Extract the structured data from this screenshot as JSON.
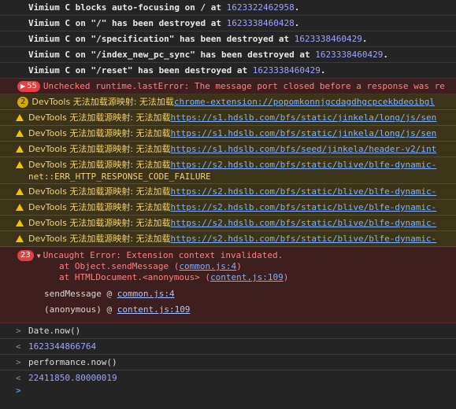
{
  "logs": [
    {
      "prefix": "Vimium C blocks auto-focusing on / at ",
      "num": "1623322462958",
      "suffix": "."
    },
    {
      "prefix": "Vimium C on \"/\" has been destroyed at ",
      "num": "1623338460428",
      "suffix": "."
    },
    {
      "prefix": "Vimium C on \"/specification\" has been destroyed at ",
      "num": "1623338460429",
      "suffix": "."
    },
    {
      "prefix": "Vimium C on \"/index_new_pc_sync\" has been destroyed at ",
      "num": "1623338460429",
      "suffix": "."
    },
    {
      "prefix": "Vimium C on \"/reset\" has been destroyed at ",
      "num": "1623338460429",
      "suffix": "."
    }
  ],
  "runtime_error": {
    "count": "55",
    "text": "Unchecked runtime.lastError: The message port closed before a response was re"
  },
  "warnings": [
    {
      "badge": "2",
      "prefix": "DevTools 无法加载源映射:  无法加载",
      "link": "chrome-extension://popomkonnjgcdagdhgcpcekbdeoibgl"
    },
    {
      "prefix": "DevTools 无法加载源映射:  无法加载",
      "link": "https://s1.hdslb.com/bfs/static/jinkela/long/js/sen"
    },
    {
      "prefix": "DevTools 无法加载源映射:  无法加载",
      "link": "https://s1.hdslb.com/bfs/static/jinkela/long/js/sen"
    },
    {
      "prefix": "DevTools 无法加载源映射:  无法加载",
      "link": "https://s1.hdslb.com/bfs/seed/jinkela/header-v2/int"
    },
    {
      "prefix": "DevTools 无法加载源映射:  无法加载",
      "link": "https://s2.hdslb.com/bfs/static/blive/blfe-dynamic-",
      "extra": "net::ERR_HTTP_RESPONSE_CODE_FAILURE"
    },
    {
      "prefix": "DevTools 无法加载源映射:  无法加载",
      "link": "https://s2.hdslb.com/bfs/static/blive/blfe-dynamic-"
    },
    {
      "prefix": "DevTools 无法加载源映射:  无法加载",
      "link": "https://s2.hdslb.com/bfs/static/blive/blfe-dynamic-"
    },
    {
      "prefix": "DevTools 无法加载源映射:  无法加载",
      "link": "https://s2.hdslb.com/bfs/static/blive/blfe-dynamic-"
    },
    {
      "prefix": "DevTools 无法加载源映射:  无法加载",
      "link": "https://s2.hdslb.com/bfs/static/blive/blfe-dynamic-"
    }
  ],
  "uncaught": {
    "count": "23",
    "title": "Uncaught Error: Extension context invalidated.",
    "stack": [
      {
        "prefix": "at Object.sendMessage (",
        "link": "common.js:4",
        "suffix": ")"
      },
      {
        "prefix": "at HTMLDocument.<anonymous> (",
        "link": "content.js:109",
        "suffix": ")"
      }
    ],
    "frames": [
      {
        "name": "sendMessage @ ",
        "link": "common.js:4"
      },
      {
        "name": "(anonymous) @ ",
        "link": "content.js:109"
      }
    ]
  },
  "repl": [
    {
      "type": "input",
      "text": "Date.now()"
    },
    {
      "type": "output",
      "text": "1623344866764"
    },
    {
      "type": "input",
      "text": "performance.now()"
    },
    {
      "type": "output",
      "text": "22411850.80000019"
    }
  ],
  "icons": {
    "input_caret": ">",
    "output_caret": "<",
    "prompt_caret": ">",
    "expand": "▼",
    "error_expand": "▶"
  },
  "colors": {
    "background": "#242424",
    "error_bg": "#3d1f1f",
    "warning_bg": "#3b3419",
    "number": "#9da3ff",
    "link": "#7fb0ff"
  }
}
